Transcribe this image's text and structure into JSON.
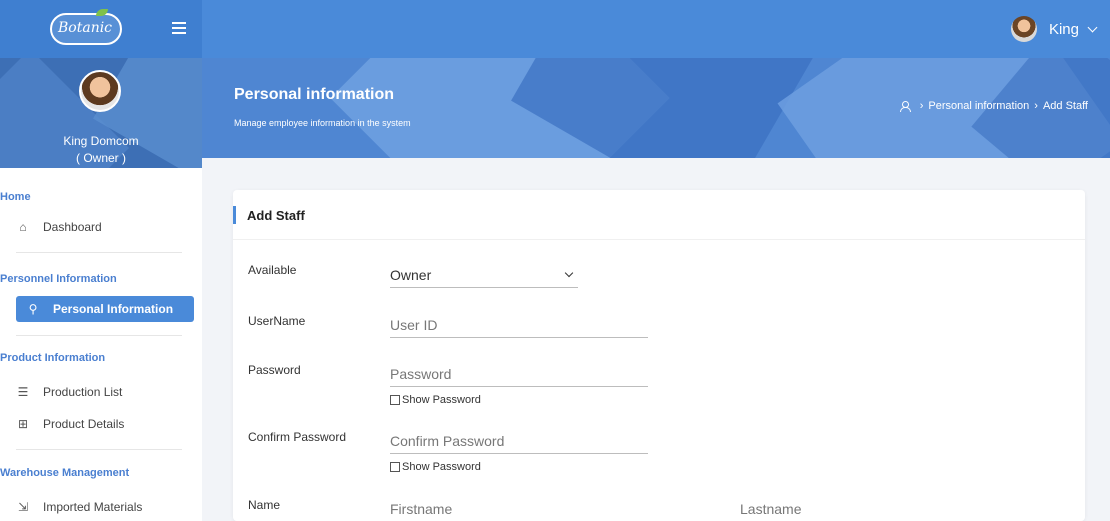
{
  "topbar": {
    "logo_text": "Botanic",
    "user_name": "King"
  },
  "profile": {
    "name": "King Domcom",
    "role": "( Owner )"
  },
  "header": {
    "title": "Personal information",
    "subtitle": "Manage employee information in the system",
    "breadcrumb": [
      "Personal information",
      "Add Staff"
    ]
  },
  "sidebar": {
    "sections": [
      {
        "title": "Home",
        "items": [
          {
            "label": "Dashboard",
            "icon": "home-icon"
          }
        ]
      },
      {
        "title": "Personnel Information",
        "items": [
          {
            "label": "Personal Information",
            "icon": "person-icon",
            "active": true
          }
        ]
      },
      {
        "title": "Product Information",
        "items": [
          {
            "label": "Production List",
            "icon": "list-icon"
          },
          {
            "label": "Product Details",
            "icon": "grid-icon"
          }
        ]
      },
      {
        "title": "Warehouse Management",
        "items": [
          {
            "label": "Imported Materials",
            "icon": "import-icon"
          }
        ]
      }
    ]
  },
  "form": {
    "card_title": "Add Staff",
    "available_label": "Available",
    "available_value": "Owner",
    "username_label": "UserName",
    "username_placeholder": "User ID",
    "password_label": "Password",
    "password_placeholder": "Password",
    "show_password_label": "Show Password",
    "confirm_label": "Confirm Password",
    "confirm_placeholder": "Confirm Password",
    "name_label": "Name",
    "firstname_placeholder": "Firstname",
    "lastname_placeholder": "Lastname"
  },
  "colors": {
    "primary": "#4a8ad9",
    "banner": "#5b8fd5",
    "section_title": "#4a7fd0"
  }
}
